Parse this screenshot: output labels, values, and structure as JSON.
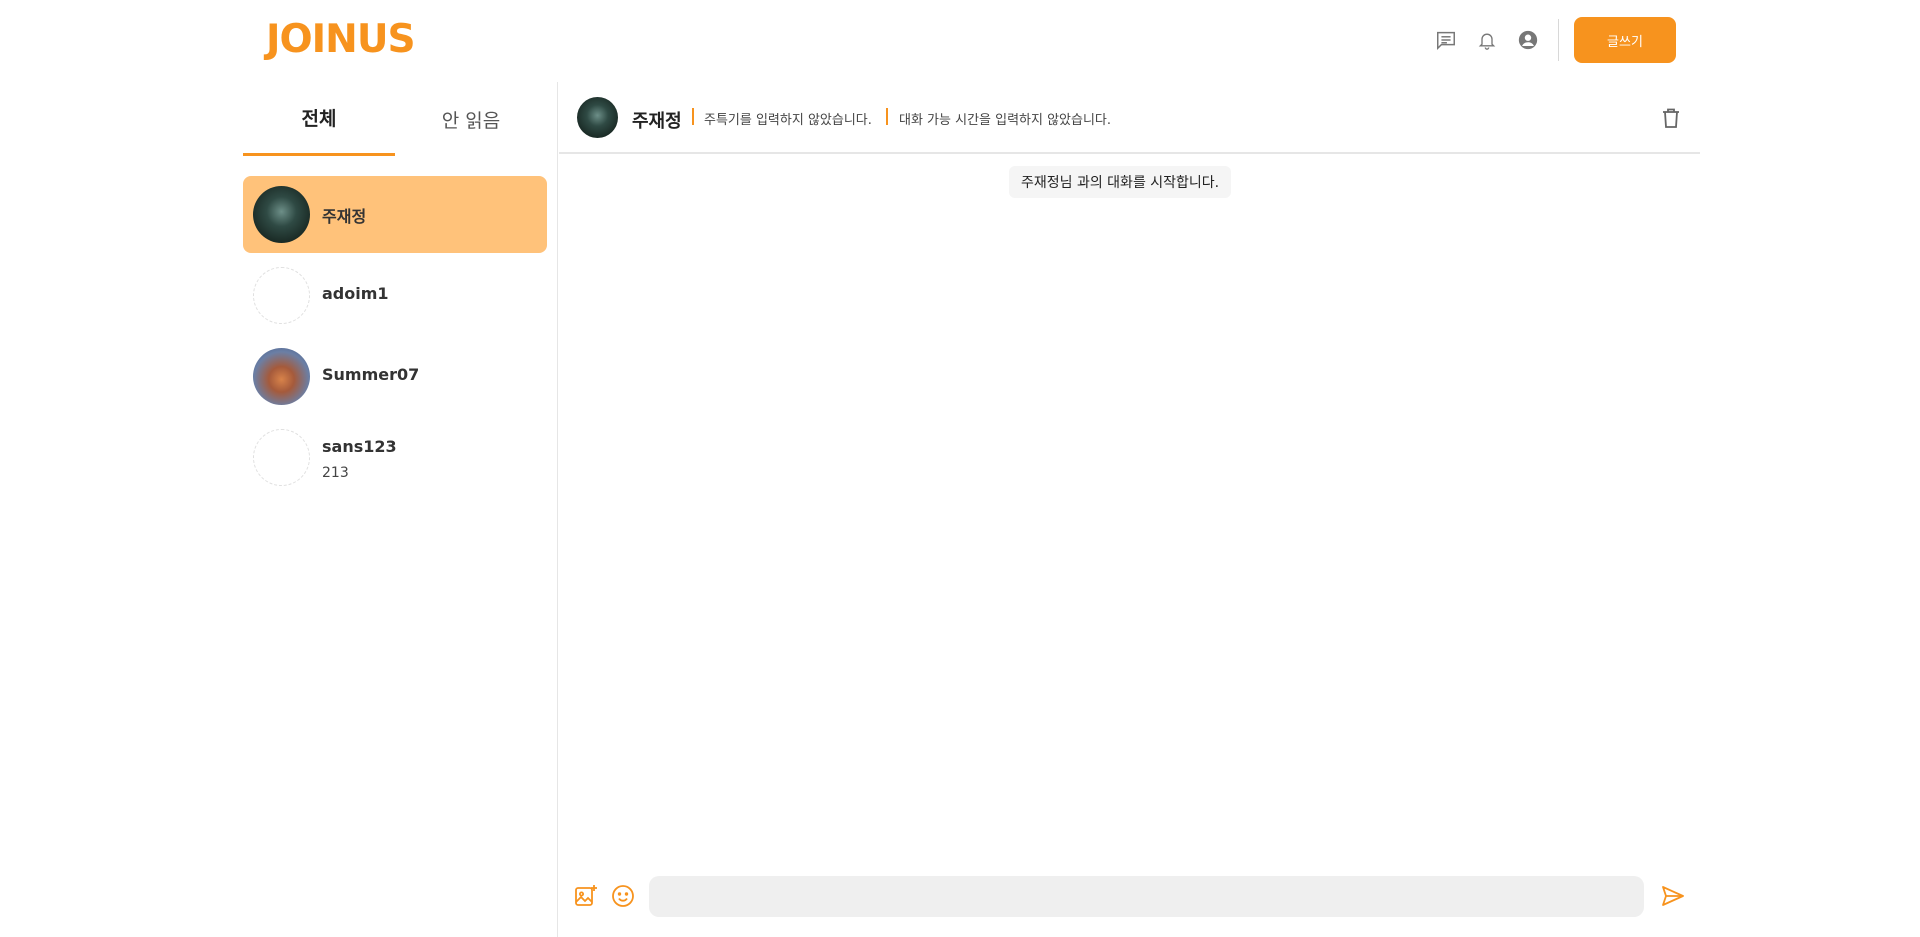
{
  "header": {
    "logo": "JOINUS",
    "icons": [
      "chat-icon",
      "bell-icon",
      "profile-icon"
    ],
    "write_label": "글쓰기"
  },
  "tabs": {
    "all": "전체",
    "unread": "안 읽음"
  },
  "rooms": [
    {
      "name": "주재정",
      "preview": "",
      "active": true
    },
    {
      "name": "adoim1",
      "preview": "",
      "active": false
    },
    {
      "name": "Summer07",
      "preview": "",
      "active": false
    },
    {
      "name": "sans123",
      "preview": "213",
      "active": false
    }
  ],
  "chat": {
    "partner_name": "주재정",
    "hobby": "주특기를 입력하지 않았습니다.",
    "available_time": "대화 가능 시간을 입력하지 않았습니다.",
    "system_message": "주재정님 과의 대화를 시작합니다.",
    "input_value": "",
    "input_placeholder": ""
  },
  "colors": {
    "accent": "#f7931e",
    "active_room": "#ffc27a",
    "input_bg": "#efefef"
  }
}
